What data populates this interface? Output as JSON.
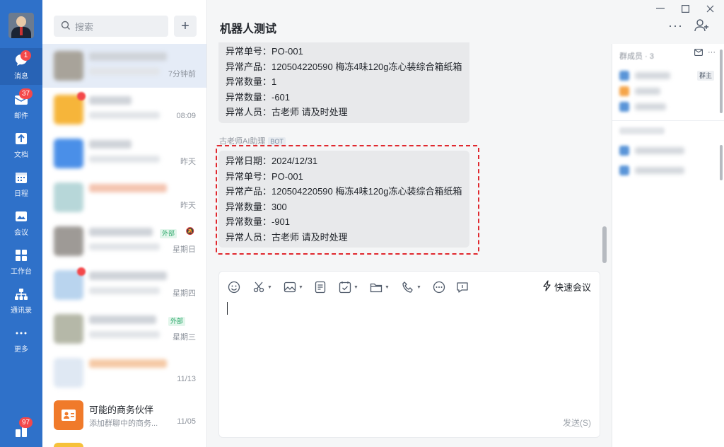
{
  "rail": {
    "items": [
      {
        "name": "messages",
        "label": "消息",
        "badge": "1",
        "icon": "chat-bubble-icon"
      },
      {
        "name": "mail",
        "label": "邮件",
        "badge": "37",
        "icon": "mail-icon"
      },
      {
        "name": "docs",
        "label": "文档",
        "icon": "document-icon"
      },
      {
        "name": "calendar",
        "label": "日程",
        "icon": "calendar-icon"
      },
      {
        "name": "meeting",
        "label": "会议",
        "icon": "meeting-icon"
      },
      {
        "name": "workbench",
        "label": "工作台",
        "icon": "grid-icon"
      },
      {
        "name": "contacts",
        "label": "通讯录",
        "icon": "org-chart-icon"
      },
      {
        "name": "more",
        "label": "更多",
        "icon": "more-dots-icon"
      }
    ],
    "bottom_badge": "97"
  },
  "conversation_list": {
    "search_placeholder": "搜索",
    "items": [
      {
        "time": "7分钟前"
      },
      {
        "time": "08:09"
      },
      {
        "time": "昨天"
      },
      {
        "time": "昨天"
      },
      {
        "time": "星期日",
        "tag": "外部"
      },
      {
        "time": "星期四"
      },
      {
        "time": "星期三",
        "tag": "外部"
      },
      {
        "time": "11/13"
      },
      {
        "name": "可能的商务伙伴",
        "preview": "添加群聊中的商务...",
        "time": "11/05"
      }
    ]
  },
  "chat": {
    "title": "机器人测试",
    "first_bubble": [
      "异常单号：PO-001",
      "异常产品：120504220590 梅冻4味120g冻心装综合箱纸箱",
      "异常数量：1",
      "异常数量：-601",
      "异常人员：古老师 请及时处理"
    ],
    "sender": "古老师AI助理",
    "sender_tag": "BOT",
    "second_bubble": [
      "异常日期：2024/12/31",
      "异常单号：PO-001",
      "异常产品：120504220590 梅冻4味120g冻心装综合箱纸箱",
      "异常数量：300",
      "异常数量：-901",
      "异常人员：古老师 请及时处理"
    ]
  },
  "composer": {
    "quick_meeting": "快速会议",
    "send": "发送(S)"
  },
  "right_panel": {
    "title": "群成员 · 3",
    "owner_tag": "群主"
  },
  "colors": {
    "rail": "#2f71c9",
    "badge": "#f4484a",
    "highlight_border": "#e0282e",
    "selected_row": "#e5ecf7"
  }
}
